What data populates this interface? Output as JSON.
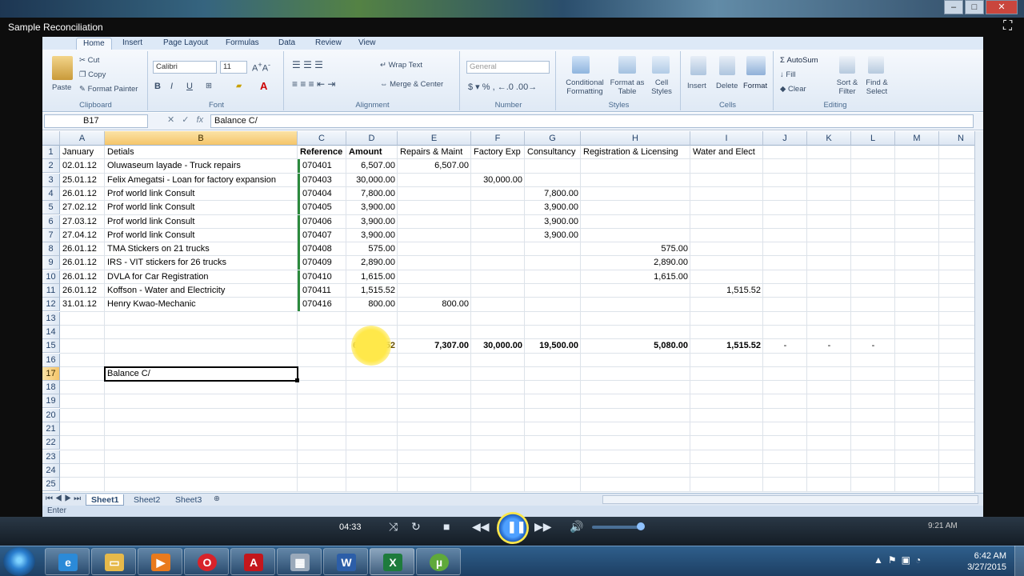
{
  "player": {
    "title": "Sample  Reconciliation",
    "time": "04:33",
    "tray_time": "9:21 AM"
  },
  "ribbon": {
    "tabs": [
      "Home",
      "Insert",
      "Page Layout",
      "Formulas",
      "Data",
      "Review",
      "View"
    ],
    "clipboard": {
      "paste": "Paste",
      "cut": "Cut",
      "copy": "Copy",
      "format_painter": "Format Painter",
      "label": "Clipboard"
    },
    "font": {
      "name": "Calibri",
      "size": "11",
      "label": "Font"
    },
    "alignment": {
      "wrap": "Wrap Text",
      "merge": "Merge & Center",
      "label": "Alignment"
    },
    "number": {
      "format": "General",
      "label": "Number"
    },
    "styles": {
      "conditional": "Conditional Formatting",
      "format_table": "Format as Table",
      "cell_styles": "Cell Styles",
      "label": "Styles"
    },
    "cells": {
      "insert": "Insert",
      "delete": "Delete",
      "format": "Format",
      "label": "Cells"
    },
    "editing": {
      "autosum": "AutoSum",
      "fill": "Fill",
      "clear": "Clear",
      "sort": "Sort & Filter",
      "find": "Find & Select",
      "label": "Editing"
    }
  },
  "formula_bar": {
    "name_box": "B17",
    "fx": "fx",
    "value": "Balance C/"
  },
  "columns": [
    "A",
    "B",
    "C",
    "D",
    "E",
    "F",
    "G",
    "H",
    "I",
    "J",
    "K",
    "L",
    "M",
    "N"
  ],
  "rows": [
    "1",
    "2",
    "3",
    "4",
    "5",
    "6",
    "7",
    "8",
    "9",
    "10",
    "11",
    "12",
    "13",
    "14",
    "15",
    "16",
    "17",
    "18",
    "19",
    "20",
    "21",
    "22",
    "23",
    "24",
    "25"
  ],
  "sheet": {
    "header": [
      "January",
      "Detials",
      "Reference",
      "Amount",
      "Repairs & Maint",
      "Factory Exp",
      "Consultancy",
      "Registration & Licensing",
      "Water and Elect"
    ],
    "data": [
      {
        "date": "02.01.12",
        "desc": "Oluwaseum layade - Truck repairs",
        "ref": "070401",
        "amount": "6,507.00",
        "e": "6,507.00",
        "f": "",
        "g": "",
        "h": "",
        "i": ""
      },
      {
        "date": "25.01.12",
        "desc": "Felix Amegatsi - Loan for factory expansion",
        "ref": "070403",
        "amount": "30,000.00",
        "e": "",
        "f": "30,000.00",
        "g": "",
        "h": "",
        "i": ""
      },
      {
        "date": "26.01.12",
        "desc": "Prof world link Consult",
        "ref": "070404",
        "amount": "7,800.00",
        "e": "",
        "f": "",
        "g": "7,800.00",
        "h": "",
        "i": ""
      },
      {
        "date": "27.02.12",
        "desc": "Prof world link Consult",
        "ref": "070405",
        "amount": "3,900.00",
        "e": "",
        "f": "",
        "g": "3,900.00",
        "h": "",
        "i": ""
      },
      {
        "date": "27.03.12",
        "desc": "Prof world link Consult",
        "ref": "070406",
        "amount": "3,900.00",
        "e": "",
        "f": "",
        "g": "3,900.00",
        "h": "",
        "i": ""
      },
      {
        "date": "27.04.12",
        "desc": "Prof world link Consult",
        "ref": "070407",
        "amount": "3,900.00",
        "e": "",
        "f": "",
        "g": "3,900.00",
        "h": "",
        "i": ""
      },
      {
        "date": "26.01.12",
        "desc": "TMA Stickers on 21 trucks",
        "ref": "070408",
        "amount": "575.00",
        "e": "",
        "f": "",
        "g": "",
        "h": "575.00",
        "i": ""
      },
      {
        "date": "26.01.12",
        "desc": "IRS - VIT stickers for 26 trucks",
        "ref": "070409",
        "amount": "2,890.00",
        "e": "",
        "f": "",
        "g": "",
        "h": "2,890.00",
        "i": ""
      },
      {
        "date": "26.01.12",
        "desc": "DVLA for Car Registration",
        "ref": "070410",
        "amount": "1,615.00",
        "e": "",
        "f": "",
        "g": "",
        "h": "1,615.00",
        "i": ""
      },
      {
        "date": "26.01.12",
        "desc": "Koffson - Water and Electricity",
        "ref": "070411",
        "amount": "1,515.52",
        "e": "",
        "f": "",
        "g": "",
        "h": "",
        "i": "1,515.52"
      },
      {
        "date": "31.01.12",
        "desc": "Henry Kwao-Mechanic",
        "ref": "070416",
        "amount": "800.00",
        "e": "800.00",
        "f": "",
        "g": "",
        "h": "",
        "i": ""
      }
    ],
    "totals": {
      "amount": "63,",
      "amount_tail": ".52",
      "e": "7,307.00",
      "f": "30,000.00",
      "g": "19,500.00",
      "h": "5,080.00",
      "i": "1,515.52",
      "j": "-",
      "k": "-",
      "l": "-"
    },
    "editing_cell": "Balance C/"
  },
  "sheet_tabs": [
    "Sheet1",
    "Sheet2",
    "Sheet3"
  ],
  "status": "Enter",
  "taskbar": {
    "clock_time": "6:42 AM",
    "clock_date": "3/27/2015"
  }
}
